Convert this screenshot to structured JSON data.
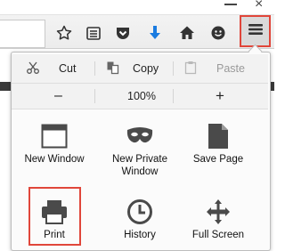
{
  "edit": {
    "cut": "Cut",
    "copy": "Copy",
    "paste": "Paste"
  },
  "zoom": {
    "minus": "–",
    "level": "100%",
    "plus": "+"
  },
  "grid": [
    {
      "label": "New Window",
      "icon": "new-window-icon"
    },
    {
      "label": "New Private Window",
      "icon": "private-mask-icon"
    },
    {
      "label": "Save Page",
      "icon": "save-page-icon"
    },
    {
      "label": "Print",
      "icon": "printer-icon"
    },
    {
      "label": "History",
      "icon": "history-clock-icon"
    },
    {
      "label": "Full Screen",
      "icon": "fullscreen-icon"
    }
  ],
  "toolbar_icons": [
    "bookmark-star-icon",
    "reading-list-icon",
    "pocket-icon",
    "download-arrow-icon",
    "home-icon",
    "hello-chat-icon",
    "hamburger-menu-icon"
  ],
  "colors": {
    "highlight": "#e0463a",
    "download": "#1a7be0"
  }
}
